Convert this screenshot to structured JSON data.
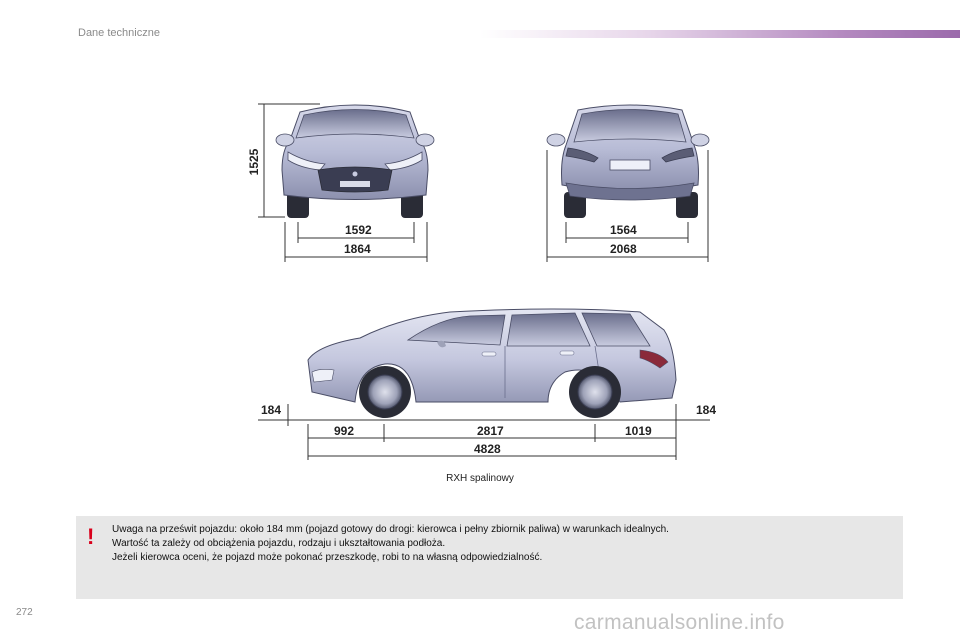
{
  "header": {
    "title": "Dane techniczne"
  },
  "front_view": {
    "height": "1525",
    "track": "1592",
    "width": "1864"
  },
  "rear_view": {
    "track": "1564",
    "width": "2068"
  },
  "side_view": {
    "ground_clearance_front": "184",
    "ground_clearance_rear": "184",
    "front_overhang": "992",
    "wheelbase": "2817",
    "rear_overhang": "1019",
    "length": "4828"
  },
  "caption": "RXH spalinowy",
  "note": {
    "icon": "warning-exclamation-icon",
    "color": "#d9001b",
    "lines": [
      "Uwaga na prześwit pojazdu: około 184 mm (pojazd gotowy do drogi: kierowca i pełny zbiornik paliwa) w warunkach idealnych.",
      "Wartość ta zależy od obciążenia pojazdu, rodzaju i ukształtowania podłoża.",
      "Jeżeli kierowca oceni, że pojazd może pokonać przeszkodę, robi to na własną odpowiedzialność."
    ]
  },
  "page_number": "272",
  "watermark": "carmanualsonline.info"
}
